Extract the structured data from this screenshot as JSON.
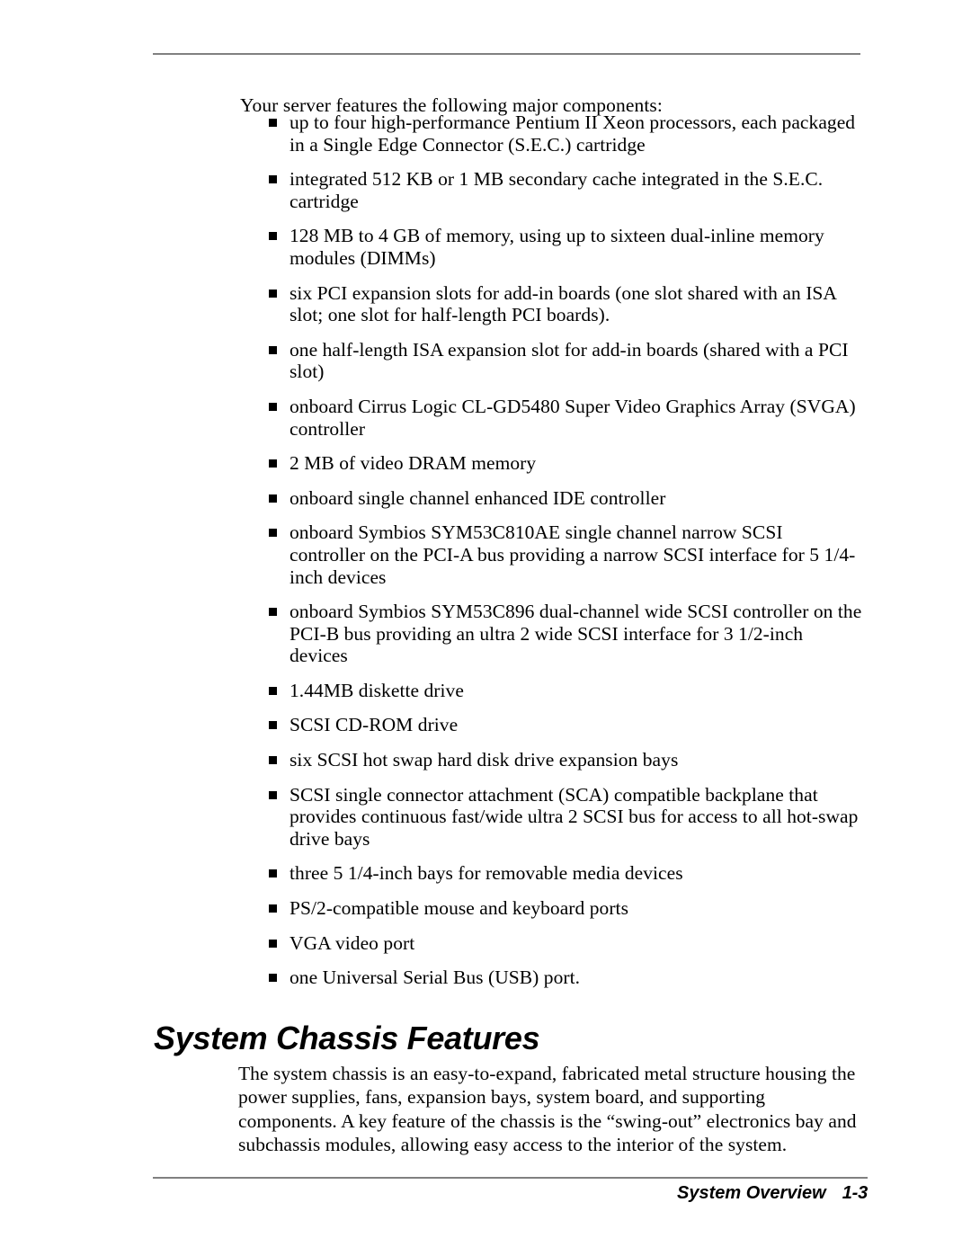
{
  "page": {
    "intro_text": "Your server features the following major components:",
    "features": [
      "up to four high-performance Pentium II Xeon processors, each packaged in a Single Edge Connector (S.E.C.) cartridge",
      "integrated 512 KB or 1 MB secondary cache integrated in the S.E.C. cartridge",
      "128 MB to 4 GB of memory, using up to sixteen dual-inline memory modules (DIMMs)",
      "six PCI expansion slots for add-in boards (one slot shared with an ISA slot; one slot for half-length PCI boards).",
      "one half-length ISA expansion slot for add-in boards (shared with a PCI slot)",
      "onboard Cirrus Logic CL-GD5480 Super Video Graphics Array (SVGA) controller",
      "2 MB of video DRAM memory",
      "onboard single channel enhanced IDE controller",
      "onboard Symbios SYM53C810AE single channel narrow SCSI controller on the PCI-A bus providing a narrow SCSI interface for 5 1/4-inch devices",
      "onboard Symbios SYM53C896 dual-channel wide SCSI controller on the PCI-B bus providing an ultra 2 wide SCSI interface for 3 1/2-inch devices",
      "1.44MB diskette drive",
      "SCSI CD-ROM drive",
      "six SCSI hot swap hard disk drive expansion bays",
      "SCSI single connector attachment (SCA) compatible backplane that provides continuous fast/wide ultra 2 SCSI bus for access to all hot-swap drive bays",
      "three 5 1/4-inch bays for removable media devices",
      "PS/2-compatible mouse and keyboard ports",
      "VGA video port",
      "one Universal Serial Bus (USB) port."
    ],
    "section_heading": "System Chassis Features",
    "closing_paragraph": "The system chassis is an easy-to-expand, fabricated metal structure housing the power supplies, fans, expansion bays, system board, and supporting components. A key feature of the chassis is the “swing-out” electronics bay and subchassis modules, allowing easy access to the interior of the system."
  },
  "footer": {
    "section_title": "System Overview",
    "page_number": "1-3"
  },
  "colors": {
    "text": "#000000",
    "rule": "#808080",
    "background": "#ffffff"
  }
}
